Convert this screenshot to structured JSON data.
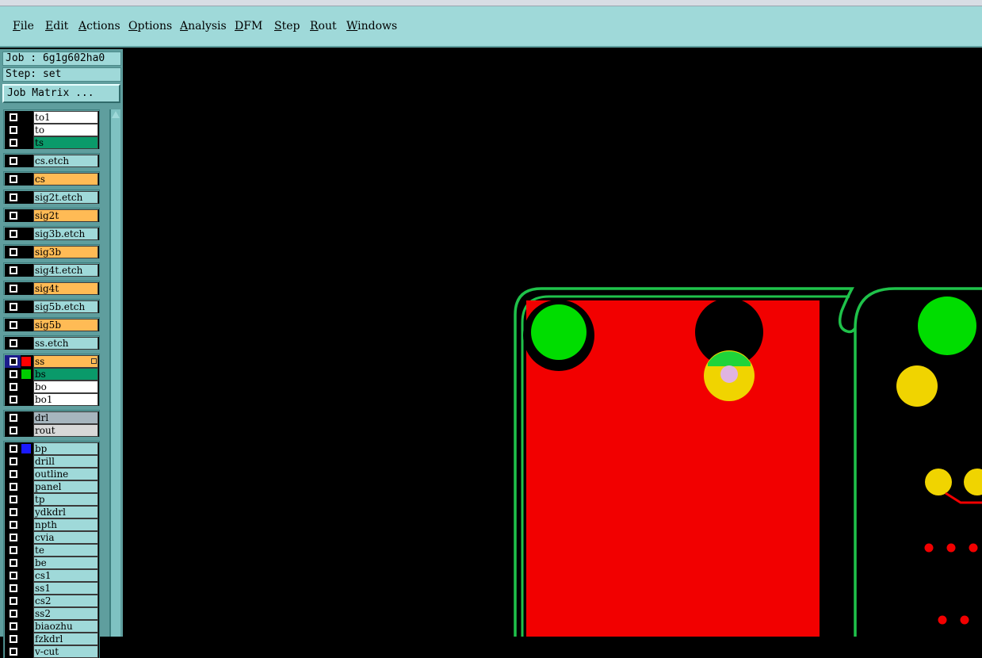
{
  "menu": [
    "File",
    "Edit",
    "Actions",
    "Options",
    "Analysis",
    "DFM",
    "Step",
    "Rout",
    "Windows"
  ],
  "info": {
    "job": "Job : 6g1g602ha0",
    "step": "Step: set"
  },
  "job_matrix_label": "Job Matrix ...",
  "colors": {
    "board_red": "#f20000",
    "outline_green": "#1fc24a",
    "pad_green": "#00dd00",
    "pad_yellow": "#f0d400"
  },
  "layer_groups": [
    [
      {
        "name": "to1",
        "style": "white"
      },
      {
        "name": "to",
        "style": "white"
      },
      {
        "name": "ts",
        "style": "green"
      }
    ],
    [
      {
        "name": "cs.etch",
        "style": "cyan"
      }
    ],
    [
      {
        "name": "cs",
        "style": "orange"
      }
    ],
    [
      {
        "name": "sig2t.etch",
        "style": "cyan"
      }
    ],
    [
      {
        "name": "sig2t",
        "style": "orange"
      }
    ],
    [
      {
        "name": "sig3b.etch",
        "style": "cyan"
      }
    ],
    [
      {
        "name": "sig3b",
        "style": "orange"
      }
    ],
    [
      {
        "name": "sig4t.etch",
        "style": "cyan"
      }
    ],
    [
      {
        "name": "sig4t",
        "style": "orange"
      }
    ],
    [
      {
        "name": "sig5b.etch",
        "style": "cyan"
      }
    ],
    [
      {
        "name": "sig5b",
        "style": "orange"
      }
    ],
    [
      {
        "name": "ss.etch",
        "style": "cyan"
      }
    ],
    [
      {
        "name": "ss",
        "style": "orange",
        "active": true,
        "swatch": "#ff0000",
        "marker": true
      },
      {
        "name": "bs",
        "style": "green",
        "swatch": "#00cc00"
      },
      {
        "name": "bo",
        "style": "white"
      },
      {
        "name": "bo1",
        "style": "white"
      }
    ],
    [
      {
        "name": "drl",
        "style": "gray"
      },
      {
        "name": "rout",
        "style": "lgray"
      }
    ],
    [
      {
        "name": "bp",
        "style": "cyan",
        "swatch": "#1a1aff"
      },
      {
        "name": "drill",
        "style": "cyan"
      },
      {
        "name": "outline",
        "style": "cyan"
      },
      {
        "name": "panel",
        "style": "cyan"
      },
      {
        "name": "tp",
        "style": "cyan"
      },
      {
        "name": "ydkdrl",
        "style": "cyan"
      },
      {
        "name": "npth",
        "style": "cyan"
      },
      {
        "name": "cvia",
        "style": "cyan"
      },
      {
        "name": "te",
        "style": "cyan"
      },
      {
        "name": "be",
        "style": "cyan"
      },
      {
        "name": "cs1",
        "style": "cyan"
      },
      {
        "name": "ss1",
        "style": "cyan"
      },
      {
        "name": "cs2",
        "style": "cyan"
      },
      {
        "name": "ss2",
        "style": "cyan"
      },
      {
        "name": "biaozhu",
        "style": "cyan"
      },
      {
        "name": "fzkdrl",
        "style": "cyan"
      },
      {
        "name": "v-cut",
        "style": "cyan"
      }
    ]
  ]
}
